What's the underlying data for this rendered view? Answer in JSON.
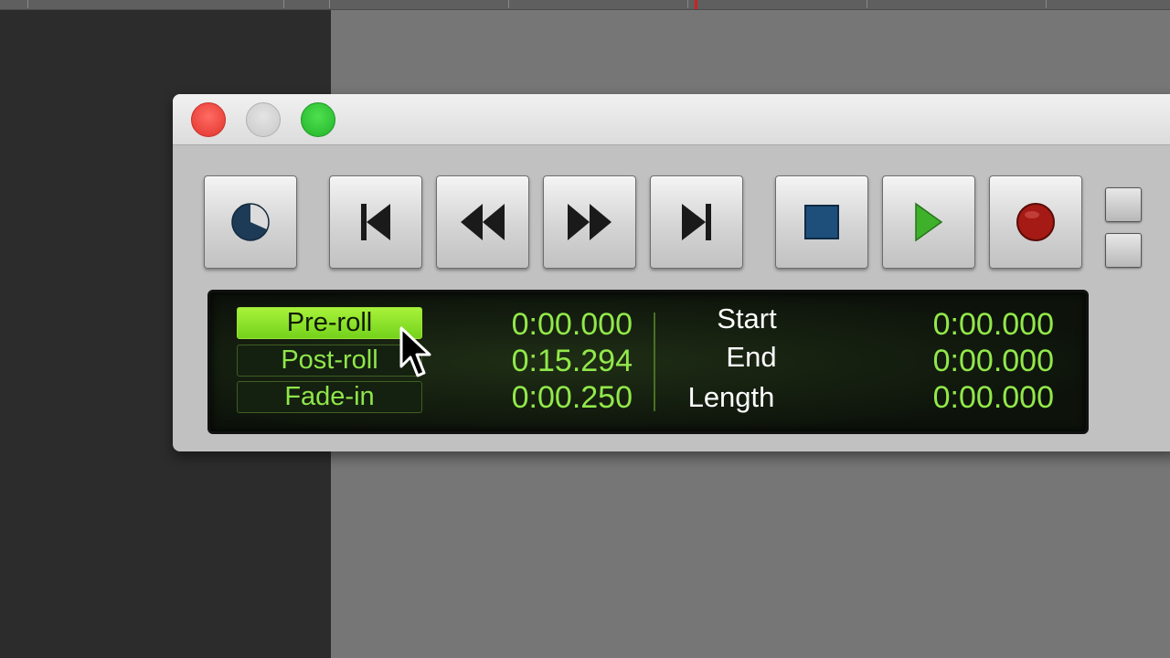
{
  "window": {
    "traffic_lights": [
      "close",
      "minimize",
      "zoom"
    ]
  },
  "transport": {
    "buttons": [
      {
        "name": "online-button",
        "icon": "clock-icon"
      },
      {
        "name": "return-to-zero-button",
        "icon": "skip-to-start-icon"
      },
      {
        "name": "rewind-button",
        "icon": "rewind-icon"
      },
      {
        "name": "fast-forward-button",
        "icon": "fast-forward-icon"
      },
      {
        "name": "go-to-end-button",
        "icon": "skip-to-end-icon"
      },
      {
        "name": "stop-button",
        "icon": "stop-icon"
      },
      {
        "name": "play-button",
        "icon": "play-icon"
      },
      {
        "name": "record-button",
        "icon": "record-icon"
      }
    ],
    "colors": {
      "play": "#3fb02a",
      "record": "#a51a14",
      "stop": "#1e4f7a",
      "clock": "#1d3b57"
    }
  },
  "counter": {
    "left": [
      {
        "label": "Pre-roll",
        "value": "0:00.000",
        "active": true
      },
      {
        "label": "Post-roll",
        "value": "0:15.294",
        "active": false
      },
      {
        "label": "Fade-in",
        "value": "0:00.250",
        "active": false
      }
    ],
    "right": [
      {
        "label": "Start",
        "value": "0:00.000"
      },
      {
        "label": "End",
        "value": "0:00.000"
      },
      {
        "label": "Length",
        "value": "0:00.000"
      }
    ],
    "colors": {
      "text": "#92e84a",
      "active_bg": "#8ee22a",
      "background": "#0f170c"
    }
  }
}
